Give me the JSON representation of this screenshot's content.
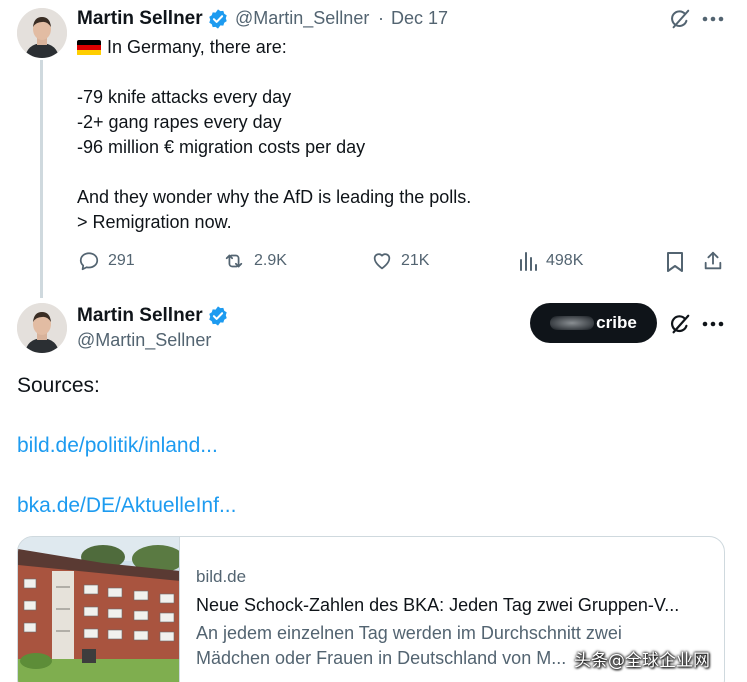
{
  "tweet": {
    "author_name": "Martin Sellner",
    "handle": "@Martin_Sellner",
    "separator": "·",
    "date": "Dec 17",
    "flag_icon": "germany-flag-icon",
    "text_lines": [
      "In Germany, there are:",
      "",
      "-79 knife attacks every day",
      "-2+ gang rapes every day",
      "-96 million € migration costs per day",
      "",
      "And they wonder why the AfD is leading the polls.",
      "> Remigration now."
    ],
    "actions": {
      "replies": "291",
      "reposts": "2.9K",
      "likes": "21K",
      "views": "498K"
    }
  },
  "reply": {
    "author_name": "Martin Sellner",
    "handle": "@Martin_Sellner",
    "subscribe_label": "cribe",
    "sources_label": "Sources:",
    "links": [
      "bild.de/politik/inland...",
      "bka.de/DE/AktuelleInf..."
    ],
    "card": {
      "domain": "bild.de",
      "title": "Neue Schock-Zahlen des BKA: Jeden Tag zwei Gruppen-V...",
      "desc_line1": "An jedem einzelnen Tag werden im Durchschnitt zwei",
      "desc_line2": "Mädchen oder Frauen in Deutschland von M..."
    }
  },
  "watermark": "头条@全球企业网",
  "colors": {
    "text": "#0f1419",
    "secondary": "#536471",
    "link": "#1d9bf0",
    "verified": "#1d9bf0",
    "border": "#cfd9de"
  }
}
